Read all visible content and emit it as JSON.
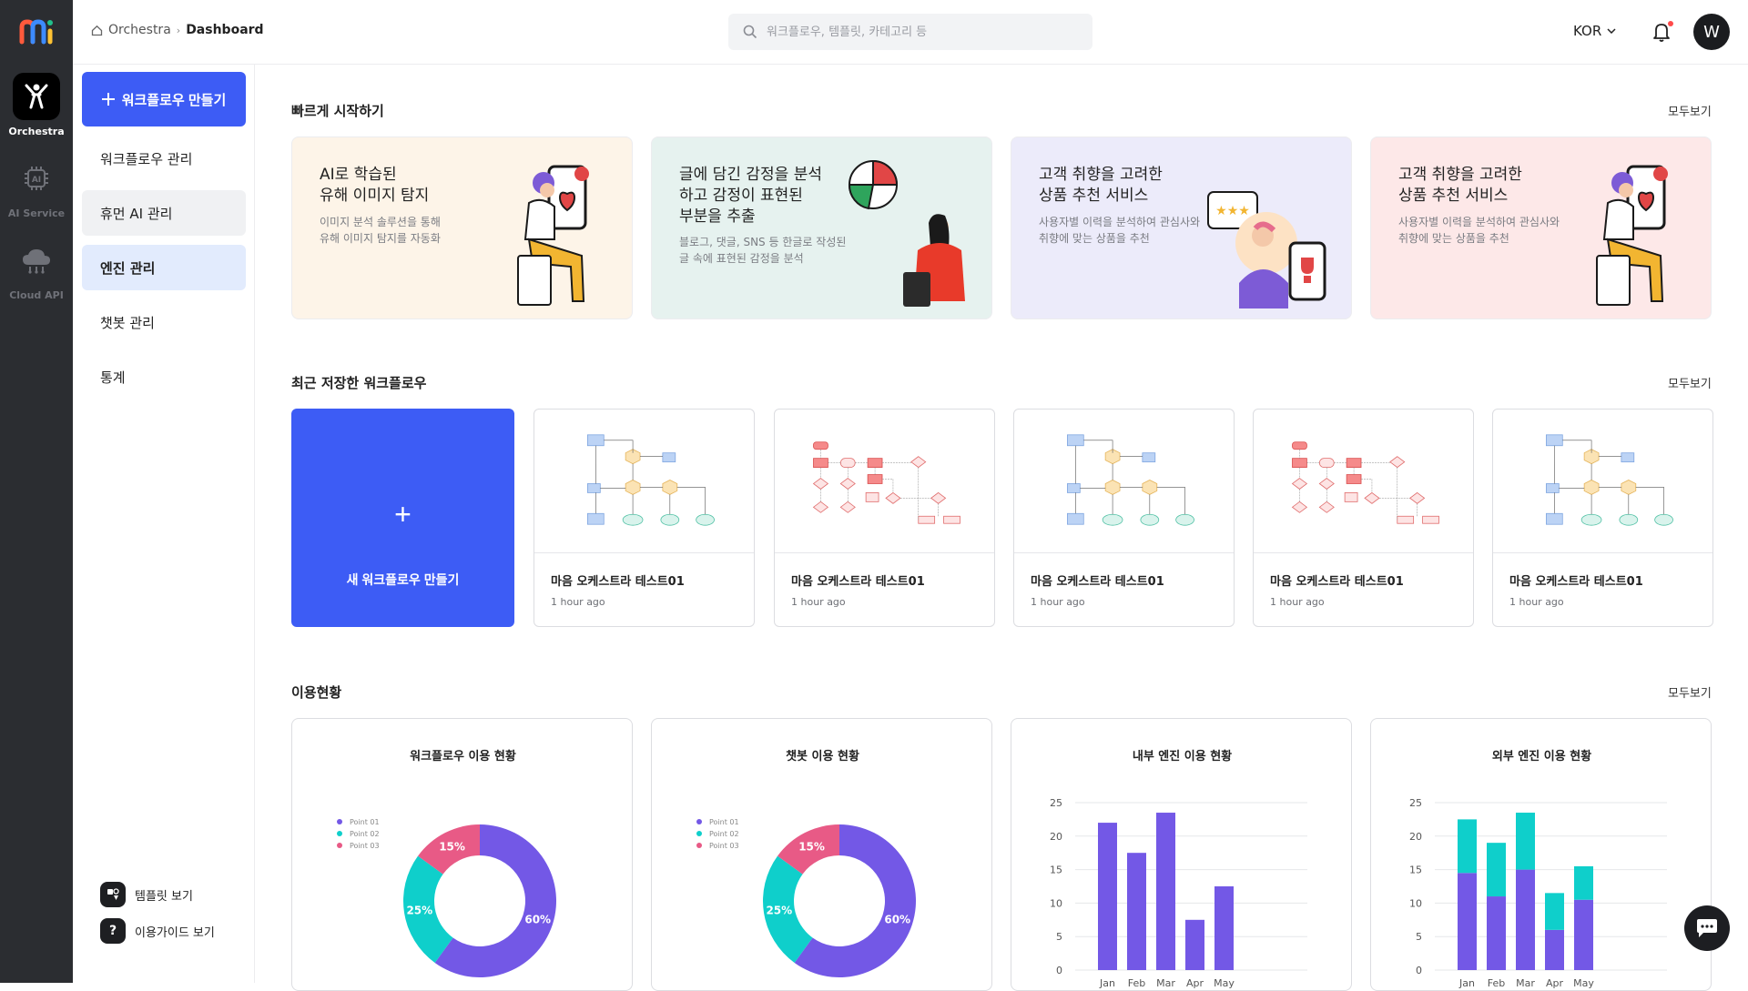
{
  "rail": {
    "items": [
      {
        "label": "Orchestra",
        "icon": "orchestra-icon",
        "active": true
      },
      {
        "label": "AI Service",
        "icon": "ai-chip-icon",
        "active": false
      },
      {
        "label": "Cloud API",
        "icon": "cloud-icon",
        "active": false
      }
    ]
  },
  "header": {
    "breadcrumb": {
      "root": "Orchestra",
      "current": "Dashboard"
    },
    "search_placeholder": "워크플로우, 템플릿, 카테고리 등",
    "language": "KOR",
    "avatar_initial": "W"
  },
  "sidebar": {
    "create_label": "워크플로우 만들기",
    "items": [
      {
        "label": "워크플로우 관리"
      },
      {
        "label": "휴먼 AI 관리"
      },
      {
        "label": "엔진 관리"
      },
      {
        "label": "챗봇 관리"
      },
      {
        "label": "통계"
      }
    ],
    "footer": {
      "templates": "템플릿 보기",
      "guide": "이용가이드 보기"
    }
  },
  "quick_start": {
    "title": "빠르게 시작하기",
    "see_all": "모두보기",
    "cards": [
      {
        "title": "AI로 학습된\n유해 이미지 탐지",
        "desc": "이미지 분석 솔루션을 통해\n유해 이미지 탐지를 자동화",
        "bg": "#fdf4e8"
      },
      {
        "title": "글에 담긴 감정을 분석\n하고 감정이 표현된\n부분을 추출",
        "desc": "블로그, 댓글, SNS 등 한글로 작성된\n글 속에 표현된 감정을 분석",
        "bg": "#e6f2ef"
      },
      {
        "title": "고객 취향을 고려한\n상품 추천 서비스",
        "desc": "사용자별 이력을 분석하여 관심사와\n취향에 맞는 상품을 추천",
        "bg": "#ecebfa"
      },
      {
        "title": "고객 취향을 고려한\n상품 추천 서비스",
        "desc": "사용자별 이력을 분석하여 관심사와\n취향에 맞는 상품을 추천",
        "bg": "#fde8e8"
      }
    ]
  },
  "recent": {
    "title": "최근 저장한 워크플로우",
    "see_all": "모두보기",
    "new_label": "새 워크플로우 만들기",
    "items": [
      {
        "name": "마음 오케스트라 테스트01",
        "time": "1 hour ago",
        "thumb": "blue"
      },
      {
        "name": "마음 오케스트라 테스트01",
        "time": "1 hour ago",
        "thumb": "red"
      },
      {
        "name": "마음 오케스트라 테스트01",
        "time": "1 hour ago",
        "thumb": "blue"
      },
      {
        "name": "마음 오케스트라 테스트01",
        "time": "1 hour ago",
        "thumb": "red"
      },
      {
        "name": "마음 오케스트라 테스트01",
        "time": "1 hour ago",
        "thumb": "blue"
      }
    ]
  },
  "usage": {
    "title": "이용현황",
    "see_all": "모두보기"
  },
  "colors": {
    "primary": "#3d5cf5",
    "purple": "#7358e6",
    "teal": "#0fcfcb",
    "pink": "#e85a86"
  },
  "chart_data": [
    {
      "type": "pie",
      "title": "워크플로우 이용 현황",
      "legend_position": "left",
      "categories": [
        "Point 01",
        "Point 02",
        "Point 03"
      ],
      "values": [
        60,
        25,
        15
      ],
      "data_labels": [
        "60%",
        "25%",
        "15%"
      ],
      "colors": [
        "#7358e6",
        "#0fcfcb",
        "#e85a86"
      ]
    },
    {
      "type": "pie",
      "title": "챗봇 이용 현황",
      "legend_position": "left",
      "categories": [
        "Point 01",
        "Point 02",
        "Point 03"
      ],
      "values": [
        60,
        25,
        15
      ],
      "data_labels": [
        "60%",
        "25%",
        "15%"
      ],
      "colors": [
        "#7358e6",
        "#0fcfcb",
        "#e85a86"
      ]
    },
    {
      "type": "bar",
      "title": "내부 엔진 이용 현황",
      "categories": [
        "Jan",
        "Feb",
        "Mar",
        "Apr",
        "May"
      ],
      "values": [
        22,
        17.5,
        23.5,
        7.5,
        12.5
      ],
      "ylim": [
        0,
        25
      ],
      "yticks": [
        0,
        5,
        10,
        15,
        20,
        25
      ],
      "grid": true,
      "colors": [
        "#7358e6"
      ]
    },
    {
      "type": "bar",
      "stacked": true,
      "title": "외부 엔진 이용 현황",
      "categories": [
        "Jan",
        "Feb",
        "Mar",
        "Apr",
        "May"
      ],
      "series": [
        {
          "values": [
            14.5,
            11,
            15,
            6,
            10.5
          ],
          "color": "#7358e6"
        },
        {
          "values": [
            8,
            8,
            8.5,
            5.5,
            5
          ],
          "color": "#0fcfcb"
        }
      ],
      "ylim": [
        0,
        25
      ],
      "yticks": [
        0,
        5,
        10,
        15,
        20,
        25
      ],
      "grid": true
    }
  ]
}
